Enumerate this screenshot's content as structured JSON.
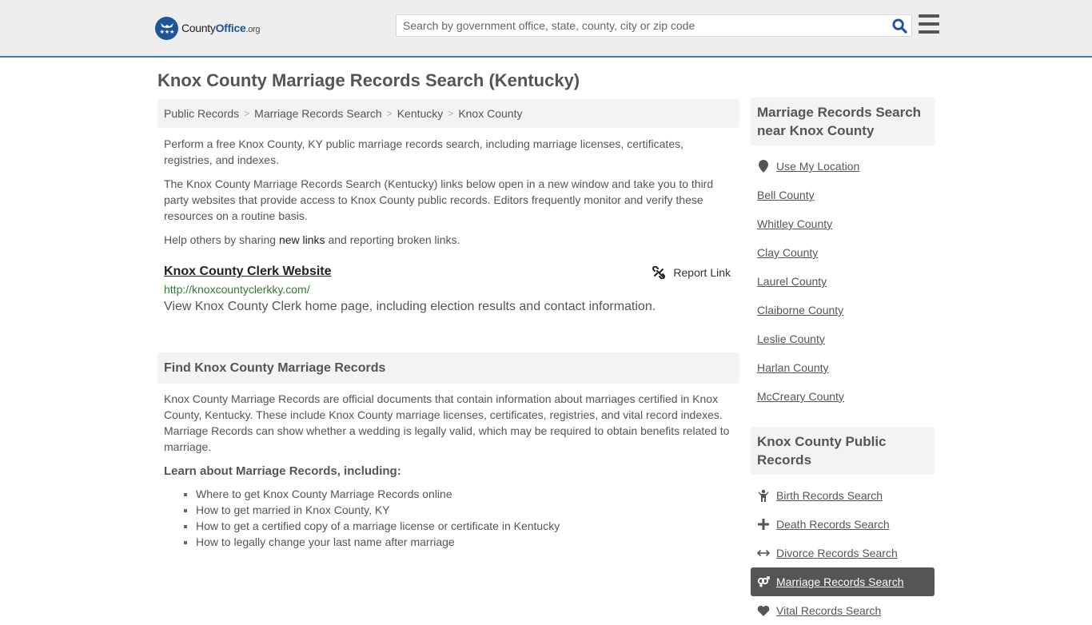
{
  "header": {
    "logo": {
      "county": "County",
      "office": "Office",
      "org": ".org"
    },
    "search": {
      "placeholder": "Search by government office, state, county, city or zip code",
      "value": ""
    },
    "icons": {
      "search": "search-icon",
      "menu": "hamburger-menu-icon"
    }
  },
  "page": {
    "title": "Knox County Marriage Records Search (Kentucky)"
  },
  "breadcrumb": [
    {
      "label": "Public Records"
    },
    {
      "label": "Marriage Records Search"
    },
    {
      "label": "Kentucky"
    },
    {
      "label": "Knox County"
    }
  ],
  "breadcrumb_separator": ">",
  "intro": {
    "p1": "Perform a free Knox County, KY public marriage records search, including marriage licenses, certificates, registries, and indexes.",
    "p2": "The Knox County Marriage Records Search (Kentucky) links below open in a new window and take you to third party websites that provide access to Knox County public records. Editors frequently monitor and verify these resources on a routine basis.",
    "p3_before": "Help others by sharing ",
    "p3_link": "new links",
    "p3_after": " and reporting broken links."
  },
  "resource": {
    "title": "Knox County Clerk Website",
    "url": "http://knoxcountyclerkky.com/",
    "description": "View Knox County Clerk home page, including election results and contact information.",
    "report_label": "Report Link"
  },
  "find_section": {
    "heading": "Find Knox County Marriage Records",
    "body": "Knox County Marriage Records are official documents that contain information about marriages certified in Knox County, Kentucky. These include Knox County marriage licenses, certificates, registries, and vital record indexes. Marriage Records can show whether a wedding is legally valid, which may be required to obtain benefits related to marriage.",
    "learn_heading": "Learn about Marriage Records, including:",
    "learn_items": [
      "Where to get Knox County Marriage Records online",
      "How to get married in Knox County, KY",
      "How to get a certified copy of a marriage license or certificate in Kentucky",
      "How to legally change your last name after marriage"
    ]
  },
  "sidebar": {
    "nearby": {
      "heading": "Marriage Records Search near Knox County",
      "use_location": "Use My Location",
      "counties": [
        "Bell County",
        "Whitley County",
        "Clay County",
        "Laurel County",
        "Claiborne County",
        "Leslie County",
        "Harlan County",
        "McCreary County"
      ]
    },
    "public_records": {
      "heading": "Knox County Public Records",
      "items": [
        {
          "label": "Birth Records Search",
          "icon": "child-icon"
        },
        {
          "label": "Death Records Search",
          "icon": "plus-icon"
        },
        {
          "label": "Divorce Records Search",
          "icon": "arrows-horizontal-icon"
        },
        {
          "label": "Marriage Records Search",
          "icon": "venus-mars-icon",
          "active": true
        },
        {
          "label": "Vital Records Search",
          "icon": "heartbeat-icon"
        }
      ]
    }
  },
  "colors": {
    "brand": "#1d5597",
    "header_bg": "#eeeeee",
    "header_border": "#3a7fb5",
    "text": "#555555",
    "url_green": "#2f7d32",
    "panel_bg": "#f3f3f3",
    "active_item_bg": "#555555"
  }
}
